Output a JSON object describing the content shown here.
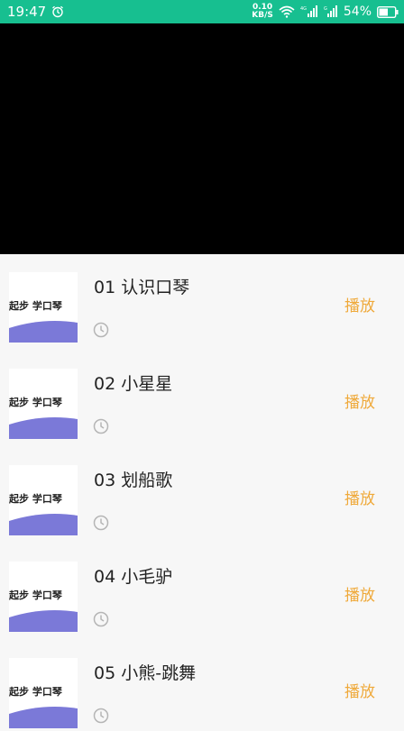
{
  "status_bar": {
    "time": "19:47",
    "net_speed_value": "0.10",
    "net_speed_unit": "KB/S",
    "network_type": "4G",
    "battery": "54%",
    "bg_color": "#17bf90"
  },
  "lessons": [
    {
      "title": "01 认识口琴",
      "play_label": "播放",
      "thumb_text": "起步 学口琴"
    },
    {
      "title": "02 小星星",
      "play_label": "播放",
      "thumb_text": "起步 学口琴"
    },
    {
      "title": "03 划船歌",
      "play_label": "播放",
      "thumb_text": "起步 学口琴"
    },
    {
      "title": "04 小毛驴",
      "play_label": "播放",
      "thumb_text": "起步 学口琴"
    },
    {
      "title": "05 小熊-跳舞",
      "play_label": "播放",
      "thumb_text": "起步 学口琴"
    }
  ],
  "colors": {
    "accent": "#efa93a",
    "thumb_wave": "#7b79d8"
  },
  "icons": {
    "alarm": "alarm-icon",
    "wifi": "wifi-icon",
    "signal": "signal-icon",
    "battery": "battery-icon",
    "clock": "clock-icon"
  }
}
